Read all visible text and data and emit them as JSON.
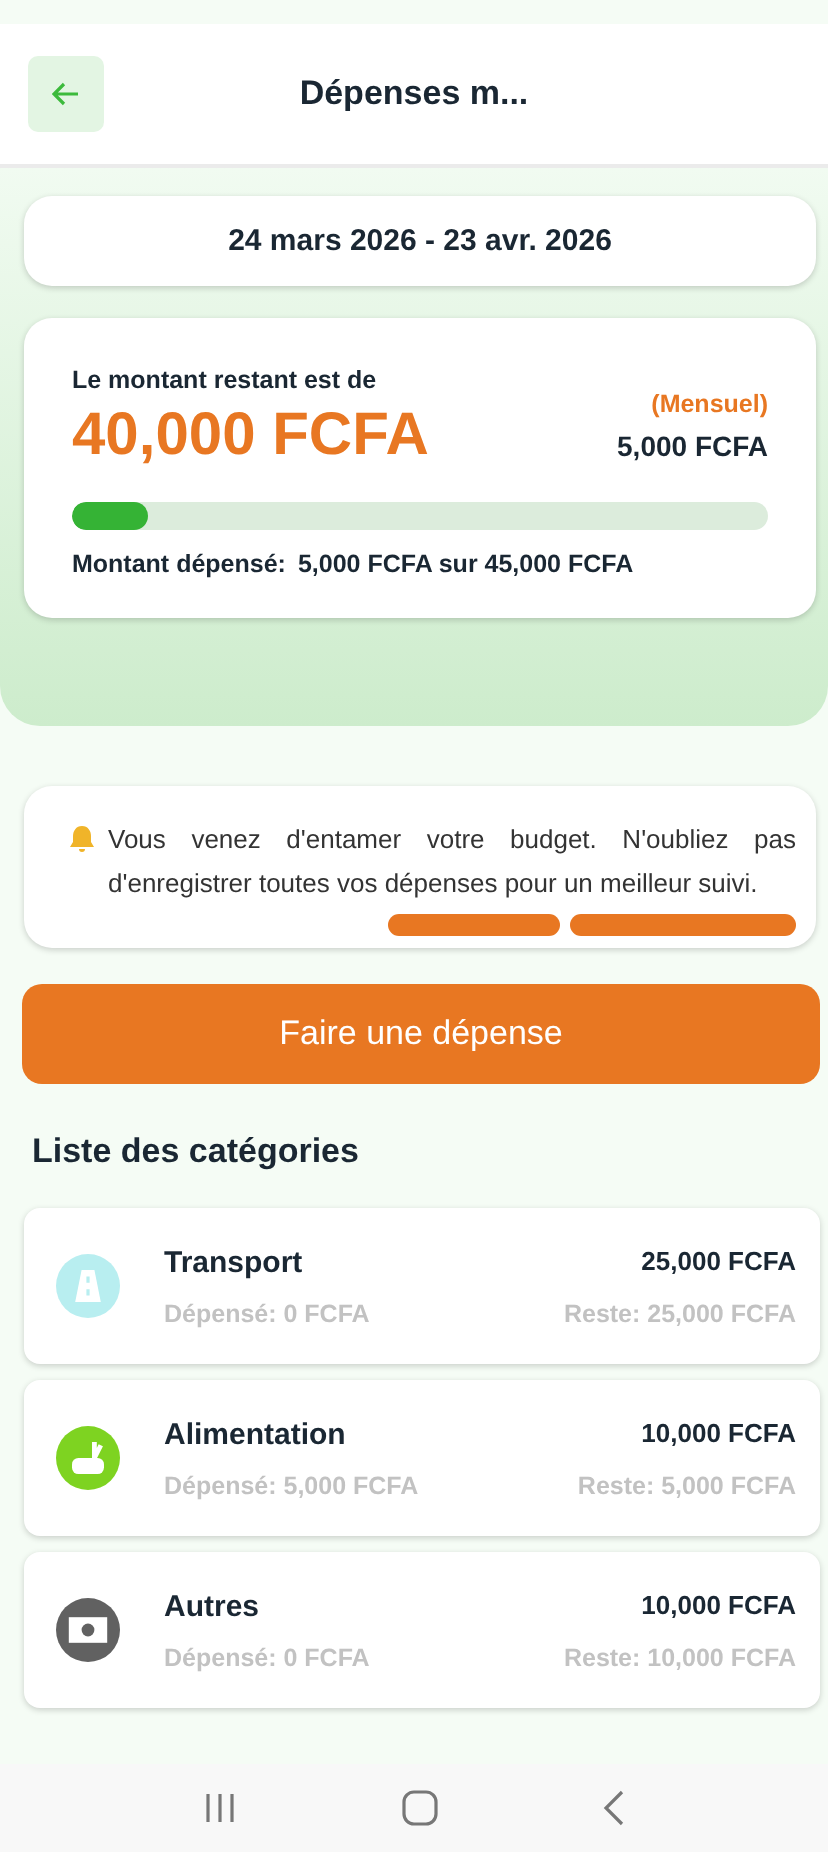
{
  "header": {
    "title": "Dépenses m..."
  },
  "period": {
    "label": "24 mars 2026 -  23 avr. 2026"
  },
  "summary": {
    "remaining_label": "Le montant restant est de",
    "remaining": "40,000 FCFA",
    "frequency": "(Mensuel)",
    "frequency_amount": "5,000 FCFA",
    "level": 0.11,
    "spent_label": "Montant dépensé:",
    "spent_text": "5,000 FCFA sur 45,000 FCFA"
  },
  "notice": {
    "text": "Vous venez d'entamer votre budget. N'oubliez pas d'enregistrer toutes vos dépenses pour un meilleur suivi."
  },
  "action_button": "Faire une dépense",
  "categories_title": "Liste des catégories",
  "categories": [
    {
      "name": "Transport",
      "kind": "road",
      "color": "#b8eef0",
      "budget": "25,000 FCFA",
      "spent": "Dépensé: 0 FCFA",
      "remaining": "Reste: 25,000 FCFA"
    },
    {
      "name": "Alimentation",
      "kind": "food",
      "color": "#7ed321",
      "budget": "10,000 FCFA",
      "spent": "Dépensé: 5,000 FCFA",
      "remaining": "Reste: 5,000 FCFA"
    },
    {
      "name": "Autres",
      "kind": "cash",
      "color": "#616161",
      "budget": "10,000 FCFA",
      "spent": "Dépensé: 0 FCFA",
      "remaining": "Reste: 10,000 FCFA"
    }
  ]
}
